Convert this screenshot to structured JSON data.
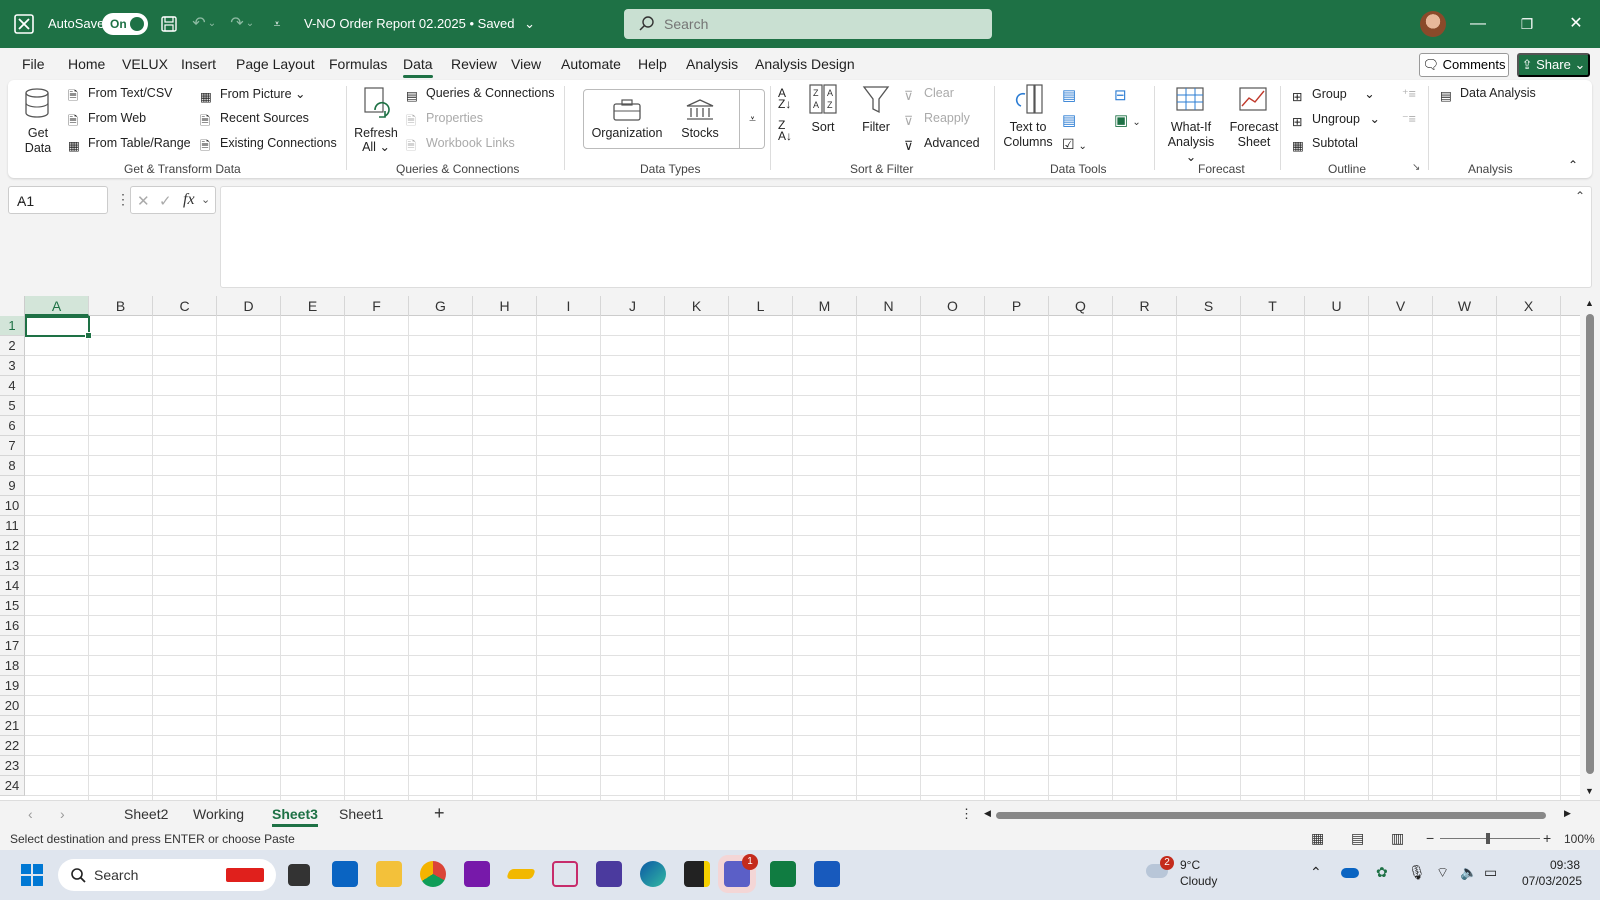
{
  "titlebar": {
    "autosave_label": "AutoSave",
    "autosave_state": "On",
    "document_title": "V-NO Order Report 02.2025",
    "save_status": "Saved",
    "search_placeholder": "Search"
  },
  "ribbon_tabs": [
    "File",
    "Home",
    "VELUX",
    "Insert",
    "Page Layout",
    "Formulas",
    "Data",
    "Review",
    "View",
    "Automate",
    "Help",
    "Analysis",
    "Analysis Design"
  ],
  "active_tab": "Data",
  "header_buttons": {
    "comments": "Comments",
    "share": "Share"
  },
  "ribbon": {
    "get_transform": {
      "get_data": "Get Data",
      "from_text_csv": "From Text/CSV",
      "from_web": "From Web",
      "from_table_range": "From Table/Range",
      "from_picture": "From Picture",
      "recent_sources": "Recent Sources",
      "existing_connections": "Existing Connections",
      "group_label": "Get & Transform Data"
    },
    "queries": {
      "refresh_all_line1": "Refresh",
      "refresh_all_line2": "All",
      "queries_connections": "Queries & Connections",
      "properties": "Properties",
      "workbook_links": "Workbook Links",
      "group_label": "Queries & Connections"
    },
    "data_types": {
      "organization": "Organization",
      "stocks": "Stocks",
      "group_label": "Data Types"
    },
    "sort_filter": {
      "sort": "Sort",
      "filter": "Filter",
      "clear": "Clear",
      "reapply": "Reapply",
      "advanced": "Advanced",
      "group_label": "Sort & Filter"
    },
    "data_tools": {
      "text_to_columns_line1": "Text to",
      "text_to_columns_line2": "Columns",
      "group_label": "Data Tools"
    },
    "forecast": {
      "what_if_line1": "What-If",
      "what_if_line2": "Analysis",
      "forecast_sheet_line1": "Forecast",
      "forecast_sheet_line2": "Sheet",
      "group_label": "Forecast"
    },
    "outline": {
      "group": "Group",
      "ungroup": "Ungroup",
      "subtotal": "Subtotal",
      "group_label": "Outline"
    },
    "analysis": {
      "data_analysis": "Data Analysis",
      "group_label": "Analysis"
    }
  },
  "formula_bar": {
    "name_box": "A1",
    "fx": "fx",
    "formula": ""
  },
  "columns": [
    "A",
    "B",
    "C",
    "D",
    "E",
    "F",
    "G",
    "H",
    "I",
    "J",
    "K",
    "L",
    "M",
    "N",
    "O",
    "P",
    "Q",
    "R",
    "S",
    "T",
    "U",
    "V",
    "W",
    "X"
  ],
  "rows": [
    "1",
    "2",
    "3",
    "4",
    "5",
    "6",
    "7",
    "8",
    "9",
    "10",
    "11",
    "12",
    "13",
    "14",
    "15",
    "16",
    "17",
    "18",
    "19",
    "20",
    "21",
    "22",
    "23",
    "24"
  ],
  "selected_cell": "A1",
  "sheets": [
    "Sheet2",
    "Working",
    "Sheet3",
    "Sheet1"
  ],
  "active_sheet": "Sheet3",
  "status": {
    "message": "Select destination and press ENTER or choose Paste",
    "zoom": "100%"
  },
  "taskbar": {
    "search_label": "Search",
    "weather_temp": "9°C",
    "weather_desc": "Cloudy",
    "weather_badge": "2",
    "teams_badge": "1",
    "time": "09:38",
    "date": "07/03/2025"
  },
  "colors": {
    "brand": "#1e7145",
    "accent_light": "#d3e5d9"
  }
}
